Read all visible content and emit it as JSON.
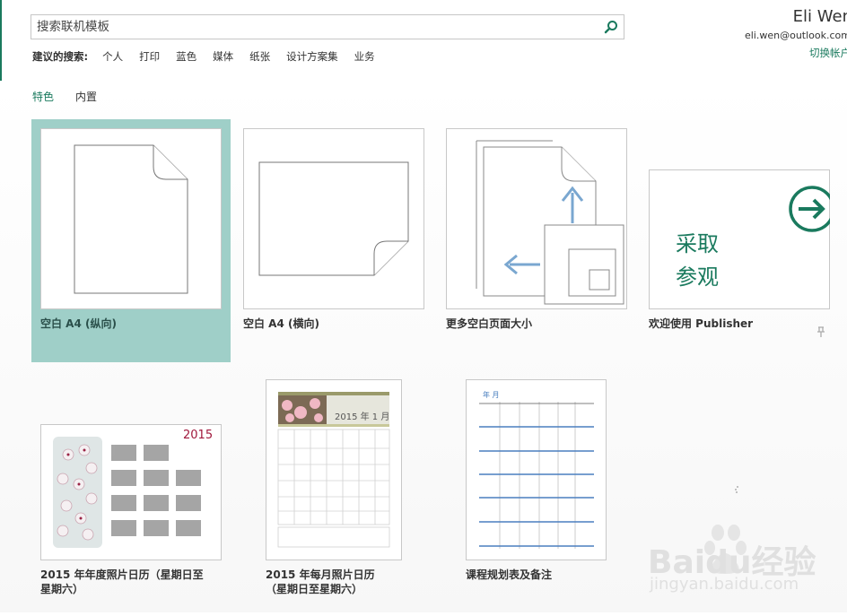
{
  "search": {
    "placeholder": "搜索联机模板"
  },
  "suggested": {
    "label": "建议的搜索:",
    "items": [
      "个人",
      "打印",
      "蓝色",
      "媒体",
      "纸张",
      "设计方案集",
      "业务"
    ]
  },
  "account": {
    "name": "Eli Wen",
    "email": "eli.wen@outlook.com",
    "switch_label": "切换帐户"
  },
  "tabs": [
    {
      "label": "特色",
      "active": true
    },
    {
      "label": "内置",
      "active": false
    }
  ],
  "templates": [
    {
      "caption": "空白 A4 (纵向)"
    },
    {
      "caption": "空白 A4 (横向)"
    },
    {
      "caption": "更多空白页面大小"
    },
    {
      "caption": "欢迎使用 Publisher",
      "tile_text_line1": "采取",
      "tile_text_line2": "参观"
    },
    {
      "caption_line1": "2015 年年度照片日历（星期日至",
      "caption_line2": "星期六）",
      "year": "2015"
    },
    {
      "caption_line1": "2015 年每月照片日历",
      "caption_line2": "（星期日至星期六）",
      "title": "2015 年 1 月"
    },
    {
      "caption": "课程规划表及备注",
      "title": "年 月"
    }
  ],
  "watermark": {
    "brand": "Baidu经验",
    "url": "jingyan.baidu.com"
  },
  "colors": {
    "accent": "#1a7a5e",
    "selected_tile": "#9fcfc8",
    "calendar_red": "#a0183c",
    "planner_blue": "#4a7fbf"
  }
}
